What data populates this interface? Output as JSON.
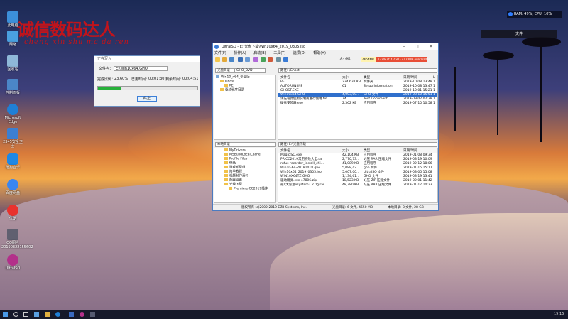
{
  "watermark": {
    "title": "诚信数码达人",
    "subtitle": "cheng xin shu ma da ren"
  },
  "desktop_icons": [
    {
      "label": "此电脑",
      "color": "#3c8fd9"
    },
    {
      "label": "网络",
      "color": "#4aa0e0"
    },
    {
      "label": "回收站",
      "color": "#8fb8d8"
    },
    {
      "label": "控制面板",
      "color": "#4b86c8"
    },
    {
      "label": "Microsoft Edge",
      "color": "#1f7fd6"
    },
    {
      "label": "2345安全卫士",
      "color": "#3b7fd2"
    },
    {
      "label": "酷狗音乐",
      "color": "#1e88e5"
    },
    {
      "label": "百度网盘",
      "color": "#3a86f0"
    },
    {
      "label": "优酷",
      "color": "#e8322d"
    },
    {
      "label": "QQ图片20190322155602",
      "color": "#606070"
    },
    {
      "label": "UltraISO",
      "color": "#b3308a"
    }
  ],
  "perf_widget": {
    "text": "RAM: 49%, CPU: 10%"
  },
  "float_button": {
    "label": "文件"
  },
  "progress_dialog": {
    "title": "正在写入",
    "file_label": "文件名：",
    "file_value": "E:\\Win10x64.GHO",
    "done_label": "完成比例：",
    "done_value": "23.60%",
    "elapsed_label": "已用时间：",
    "elapsed_value": "00:01:30",
    "remaining_label": "剩余时间：",
    "remaining_value": "00:04:51",
    "progress": 0.236,
    "cancel_label": "终止"
  },
  "ultraiso": {
    "title": "UltraISO - E:\\光盘下载\\Win10x64_2019_0305.iso",
    "menu": [
      "文件(F)",
      "操作(A)",
      "启动(B)",
      "工具(T)",
      "选项(O)",
      "帮助(H)"
    ],
    "size_label": "大小总计",
    "size_value": "4654MB",
    "size_bar_text": "172% of 4.7GB - 4478MB overloaded",
    "iso_label": "光盘目录",
    "iso_name": "GHO_DVD",
    "iso_path_label": "路径:",
    "iso_path": "/Ghost",
    "tree_iso": [
      "Win10_x64_专业版",
      "Ghost",
      "PE",
      "驱动程序目录"
    ],
    "columns": [
      "文件名",
      "大小",
      "类型",
      "日期/时间",
      "L"
    ],
    "iso_files": [
      {
        "name": "PE",
        "size": "234,637 KB",
        "type": "文件夹",
        "date": "2019-10-08 13:48",
        "l": "1",
        "selected": false
      },
      {
        "name": "AUTORUN.INF",
        "size": "61",
        "type": "Setup Information",
        "date": "2019-10-08 13:47",
        "l": "1",
        "selected": false
      },
      {
        "name": "GHOST.EXE",
        "size": "",
        "type": "",
        "date": "2019-10-01 15:21",
        "l": "1",
        "selected": false
      },
      {
        "name": "Win10x64.GHO",
        "size": "4,003,00...",
        "type": "GHO 文件",
        "date": "2019-08-10 15:51",
        "l": "1",
        "selected": true
      },
      {
        "name": "请先看此使用说明再进行使用.txt",
        "size": "74",
        "type": "Text Document",
        "date": "2019-09-02 02:38",
        "l": "1",
        "selected": false
      },
      {
        "name": "硬盘安装器.exe",
        "size": "2,362 KB",
        "type": "应用程序",
        "date": "2019-07-10 10:58",
        "l": "1",
        "selected": false
      }
    ],
    "local_label": "本地目录",
    "local_path_label": "路径:",
    "local_path": "E:\\光盘下载",
    "tree_local": [
      "MyDrivers",
      "MSBuildLocalCache",
      "Profile Files",
      "壁纸",
      "游戏卸载组",
      "简单教程",
      "视频制作素材",
      "配置设置",
      "光盘下载",
      "Premiere CC2019插件"
    ],
    "local_files": [
      {
        "name": "MagicISO.exe",
        "size": "42,104 KB",
        "type": "应用程序",
        "date": "2019-01-08 09:34"
      },
      {
        "name": "PR CC2019常用特效大全.rar",
        "size": "2,770,73...",
        "type": "好压 RAR 压缩文件",
        "date": "2019-03-19 10:09"
      },
      {
        "name": "rufus-recorder_install_chi...",
        "size": "41,089 KB",
        "type": "应用程序",
        "date": "2019-02-12 18:06"
      },
      {
        "name": "Win10-64-20181018.gho",
        "size": "5,088,42...",
        "type": "gho 文件",
        "date": "2019-01-15 15:17"
      },
      {
        "name": "Win10x64_2019_0305.iso",
        "size": "5,007,00...",
        "type": "UltraISO 文件",
        "date": "2019-03-05 15:08"
      },
      {
        "name": "WIN10X64TZ.GHO",
        "size": "1,134,61...",
        "type": "GHO 文件",
        "date": "2019-03-19 13:41"
      },
      {
        "name": "驱动精灵.exe 47806.zip",
        "size": "18,523 KB",
        "type": "好压 ZIP 压缩文件",
        "date": "2019-02-01 11:42"
      },
      {
        "name": "最Y大容量xsystem2.2.0g.rar",
        "size": "48,780 KB",
        "type": "好压 RAR 压缩文件",
        "date": "2019-01-17 10:23"
      }
    ],
    "status": {
      "copyright": "版权所有 (c)2002-2019 EZB Systems, Inc.",
      "iso_info": "光盘目录: 6 文件, 4650 MB",
      "local_info": "本地目录: 8 文件, 28 GB"
    }
  },
  "taskbar": {
    "time": "19:15"
  }
}
